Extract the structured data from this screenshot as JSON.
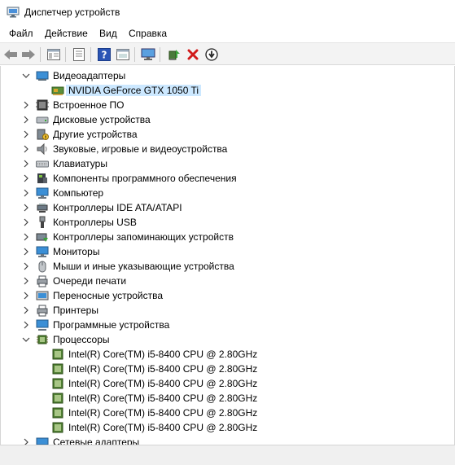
{
  "window": {
    "title": "Диспетчер устройств"
  },
  "menu": [
    "Файл",
    "Действие",
    "Вид",
    "Справка"
  ],
  "toolbar": {
    "buttons": [
      "back-arrow-icon",
      "forward-arrow-icon",
      "properties-list-icon",
      "properties-sheet-icon",
      "help-icon",
      "view-icon",
      "monitor-icon",
      "update-driver-icon",
      "uninstall-icon",
      "download-icon"
    ]
  },
  "tree": {
    "categories": [
      {
        "label": "Видеоадаптеры",
        "expanded": true,
        "icon": "display-adapter-icon"
      },
      {
        "label": "NVIDIA GeForce GTX 1050 Ti",
        "child": true,
        "selected": true,
        "icon": "gpu-icon"
      },
      {
        "label": "Встроенное ПО",
        "icon": "firmware-icon"
      },
      {
        "label": "Дисковые устройства",
        "icon": "disk-icon"
      },
      {
        "label": "Другие устройства",
        "icon": "other-device-icon"
      },
      {
        "label": "Звуковые, игровые и видеоустройства",
        "icon": "speaker-icon"
      },
      {
        "label": "Клавиатуры",
        "icon": "keyboard-icon"
      },
      {
        "label": "Компоненты программного обеспечения",
        "icon": "software-component-icon"
      },
      {
        "label": "Компьютер",
        "icon": "computer-icon"
      },
      {
        "label": "Контроллеры IDE ATA/ATAPI",
        "icon": "ide-controller-icon"
      },
      {
        "label": "Контроллеры USB",
        "icon": "usb-icon"
      },
      {
        "label": "Контроллеры запоминающих устройств",
        "icon": "storage-controller-icon"
      },
      {
        "label": "Мониторы",
        "icon": "monitor-icon"
      },
      {
        "label": "Мыши и иные указывающие устройства",
        "icon": "mouse-icon"
      },
      {
        "label": "Очереди печати",
        "icon": "print-queue-icon"
      },
      {
        "label": "Переносные устройства",
        "icon": "portable-device-icon"
      },
      {
        "label": "Принтеры",
        "icon": "printer-icon"
      },
      {
        "label": "Программные устройства",
        "icon": "software-device-icon"
      },
      {
        "label": "Процессоры",
        "expanded": true,
        "icon": "processor-icon"
      },
      {
        "label": "Intel(R) Core(TM) i5-8400 CPU @ 2.80GHz",
        "child": true,
        "icon": "cpu-icon"
      },
      {
        "label": "Intel(R) Core(TM) i5-8400 CPU @ 2.80GHz",
        "child": true,
        "icon": "cpu-icon"
      },
      {
        "label": "Intel(R) Core(TM) i5-8400 CPU @ 2.80GHz",
        "child": true,
        "icon": "cpu-icon"
      },
      {
        "label": "Intel(R) Core(TM) i5-8400 CPU @ 2.80GHz",
        "child": true,
        "icon": "cpu-icon"
      },
      {
        "label": "Intel(R) Core(TM) i5-8400 CPU @ 2.80GHz",
        "child": true,
        "icon": "cpu-icon"
      },
      {
        "label": "Intel(R) Core(TM) i5-8400 CPU @ 2.80GHz",
        "child": true,
        "icon": "cpu-icon"
      },
      {
        "label": "Сетевые адаптеры",
        "icon": "network-adapter-icon"
      }
    ]
  }
}
